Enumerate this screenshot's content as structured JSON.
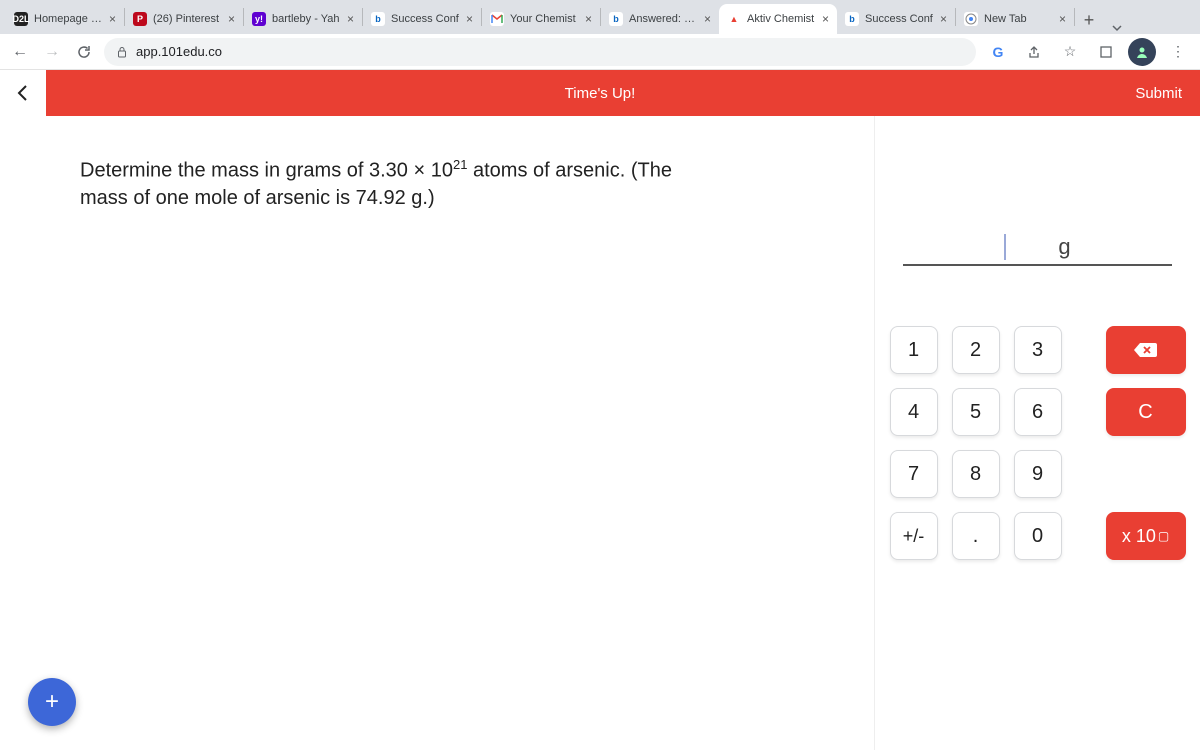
{
  "browser": {
    "tabs": [
      {
        "favicon_bg": "#222",
        "favicon_text": "D2L",
        "label": "Homepage - S",
        "active": false
      },
      {
        "favicon_bg": "#bd081c",
        "favicon_text": "P",
        "label": "(26) Pinterest",
        "active": false
      },
      {
        "favicon_bg": "#5f01d1",
        "favicon_text": "y!",
        "label": "bartleby - Yah",
        "active": false
      },
      {
        "favicon_bg": "#0a66c2",
        "favicon_text": "b",
        "label": "Success Conf",
        "active": false
      },
      {
        "favicon_bg": "#fff",
        "favicon_text": "M",
        "label": "Your Chemist",
        "active": false,
        "gmail": true
      },
      {
        "favicon_bg": "#0a66c2",
        "favicon_text": "b",
        "label": "Answered: Qu",
        "active": false
      },
      {
        "favicon_bg": "#e93f33",
        "favicon_text": "▲",
        "label": "Aktiv Chemist",
        "active": true
      },
      {
        "favicon_bg": "#0a66c2",
        "favicon_text": "b",
        "label": "Success Conf",
        "active": false
      },
      {
        "favicon_bg": "#fff",
        "favicon_text": "G",
        "label": "New Tab",
        "active": false,
        "google": true
      }
    ],
    "url": "app.101edu.co"
  },
  "header": {
    "timer": "Time's Up!",
    "submit": "Submit"
  },
  "question": {
    "line1": "Determine the mass in grams of 3.30 × 10",
    "exp": "21",
    "line1b": " atoms of arsenic. (The",
    "line2": "mass of one mole of arsenic is 74.92 g.)"
  },
  "answer": {
    "unit": "g"
  },
  "keypad": {
    "k1": "1",
    "k2": "2",
    "k3": "3",
    "k4": "4",
    "k5": "5",
    "k6": "6",
    "k7": "7",
    "k8": "8",
    "k9": "9",
    "pm": "+/-",
    "dot": ".",
    "k0": "0",
    "clear": "C",
    "sci": "x 10",
    "sciexp": "▢"
  }
}
